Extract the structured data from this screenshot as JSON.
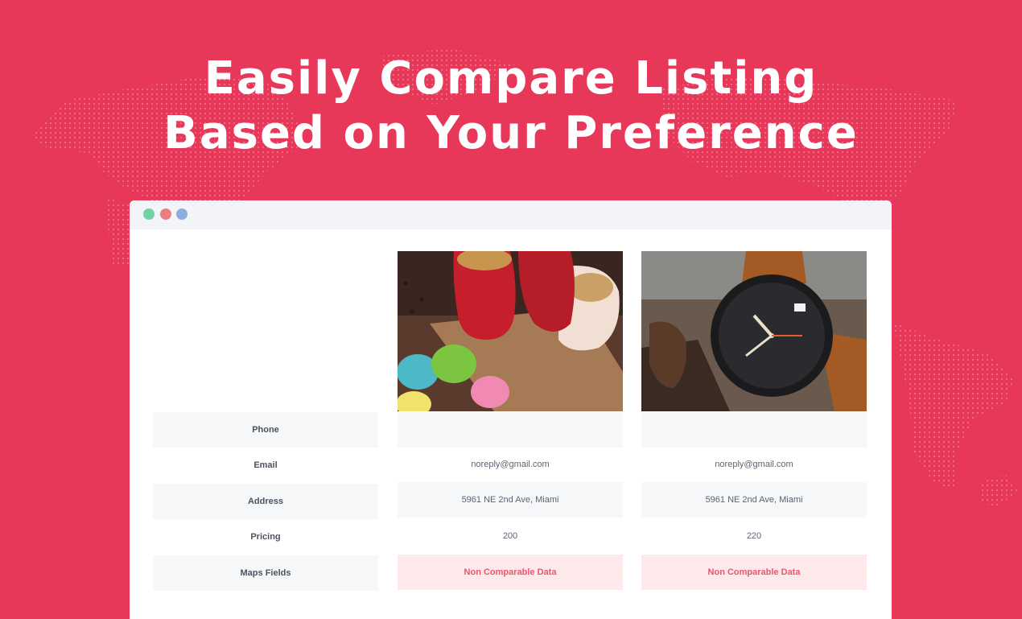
{
  "headline": {
    "line1": "Easily Compare Listing",
    "line2": "Based on Your Preference"
  },
  "window": {
    "controls": [
      "green-dot",
      "red-dot",
      "blue-dot"
    ]
  },
  "compare": {
    "rows": [
      {
        "label": "Phone",
        "values": [
          "",
          ""
        ]
      },
      {
        "label": "Email",
        "values": [
          "noreply@gmail.com",
          "noreply@gmail.com"
        ]
      },
      {
        "label": "Address",
        "values": [
          "5961 NE 2nd Ave, Miami",
          "5961 NE 2nd Ave, Miami"
        ]
      },
      {
        "label": "Pricing",
        "values": [
          "200",
          "220"
        ]
      },
      {
        "label": "Maps Fields",
        "values": [
          "Non Comparable Data",
          "Non Comparable Data"
        ]
      }
    ]
  },
  "colors": {
    "background": "#e8385a",
    "non_comparable_bg": "#fde8ea",
    "non_comparable_text": "#e8576c"
  }
}
